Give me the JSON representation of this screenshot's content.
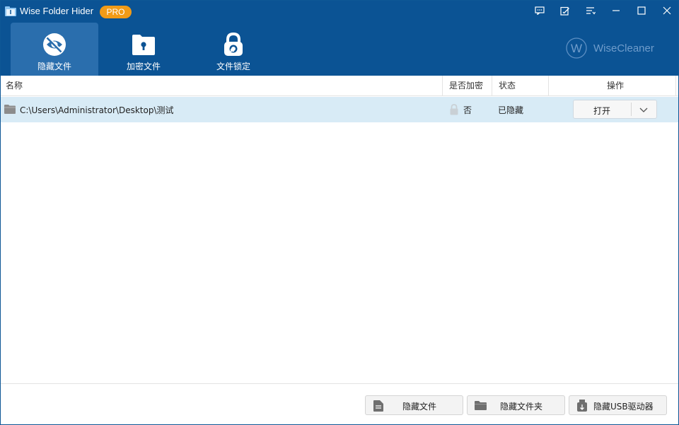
{
  "app": {
    "title": "Wise Folder Hider",
    "badge": "PRO",
    "brand": "WiseCleaner",
    "brand_mark": "W"
  },
  "titlebar_buttons": [
    "feedback-icon",
    "edit-icon",
    "menu-icon",
    "minimize-icon",
    "maximize-icon",
    "close-icon"
  ],
  "tabs": [
    {
      "label": "隐藏文件",
      "icon": "eye-hidden-icon",
      "active": true
    },
    {
      "label": "加密文件",
      "icon": "folder-lock-icon",
      "active": false
    },
    {
      "label": "文件锁定",
      "icon": "padlock-icon",
      "active": false
    }
  ],
  "table": {
    "columns": [
      "名称",
      "是否加密",
      "状态",
      "操作"
    ],
    "rows": [
      {
        "path": "C:\\Users\\Administrator\\Desktop\\测试",
        "encrypted": "否",
        "status": "已隐藏",
        "action": "打开"
      }
    ]
  },
  "footer": {
    "buttons": [
      {
        "label": "隐藏文件",
        "icon": "file-icon"
      },
      {
        "label": "隐藏文件夹",
        "icon": "folder-icon"
      },
      {
        "label": "隐藏USB驱动器",
        "icon": "usb-drive-icon"
      }
    ]
  },
  "colors": {
    "header": "#0b5394",
    "active_tab": "#2a6ead",
    "badge": "#f29b17",
    "selected_row": "#d8ebf6"
  }
}
